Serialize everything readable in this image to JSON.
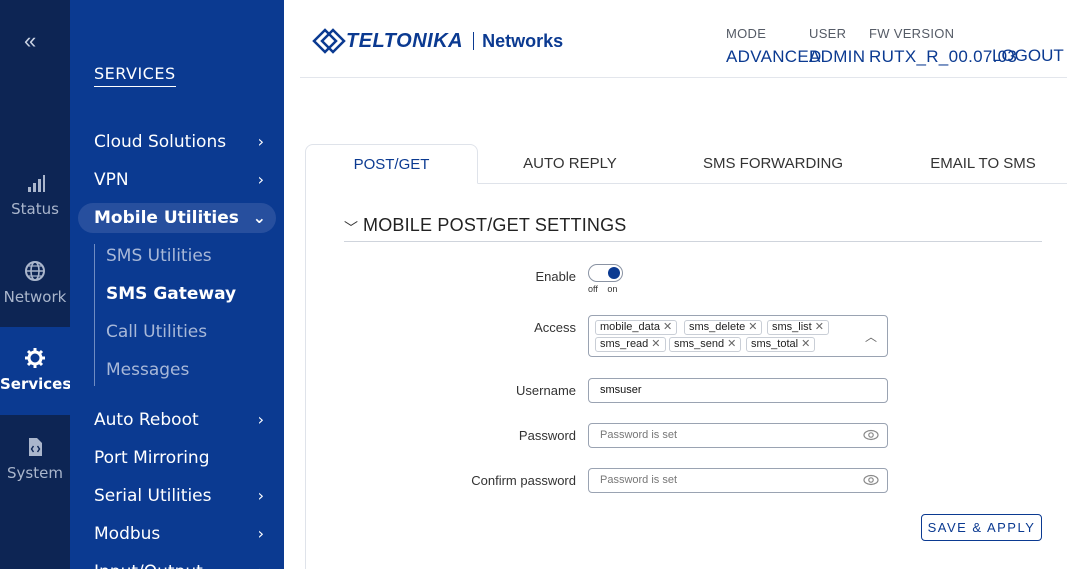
{
  "rail": {
    "collapse": "«",
    "items": [
      {
        "label": "Status",
        "icon": "signal-bars-icon"
      },
      {
        "label": "Network",
        "icon": "globe-icon"
      },
      {
        "label": "Services",
        "icon": "gear-icon"
      },
      {
        "label": "System",
        "icon": "file-code-icon"
      }
    ]
  },
  "menu": {
    "title": "SERVICES",
    "items": [
      "Cloud Solutions",
      "VPN",
      "Mobile Utilities"
    ],
    "subitems": [
      "SMS Utilities",
      "SMS Gateway",
      "Call Utilities",
      "Messages"
    ],
    "after": [
      "Auto Reboot",
      "Port Mirroring",
      "Serial Utilities",
      "Modbus",
      "Input/Output"
    ]
  },
  "header": {
    "logo_text": "TELTONIKA",
    "logo_networks": "Networks",
    "mode_label": "MODE",
    "mode_value": "ADVANCED",
    "user_label": "USER",
    "user_value": "ADMIN",
    "fw_label": "FW VERSION",
    "fw_value": "RUTX_R_00.07.03",
    "logout": "LOGOUT"
  },
  "tabs": [
    "POST/GET",
    "AUTO REPLY",
    "SMS FORWARDING",
    "EMAIL TO SMS"
  ],
  "section": {
    "title": "MOBILE POST/GET SETTINGS"
  },
  "form": {
    "enable_label": "Enable",
    "toggle_off": "off",
    "toggle_on": "on",
    "access_label": "Access",
    "access_chips": [
      "mobile_data",
      "sms_delete",
      "sms_list",
      "sms_read",
      "sms_send",
      "sms_total"
    ],
    "username_label": "Username",
    "username_value": "smsuser",
    "password_label": "Password",
    "password_placeholder": "Password is set",
    "confirm_label": "Confirm password",
    "confirm_placeholder": "Password is set",
    "save_button": "SAVE & APPLY"
  },
  "colors": {
    "brand": "#0b3a91",
    "rail": "#0d2554"
  }
}
